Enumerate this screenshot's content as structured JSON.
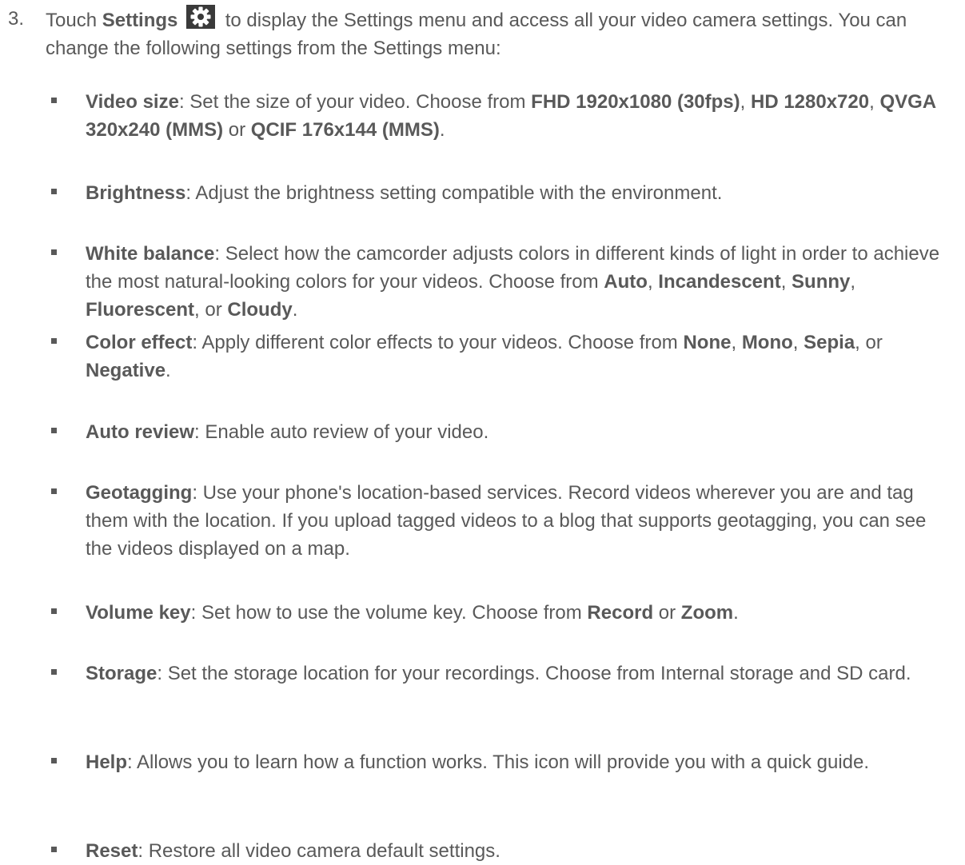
{
  "step": {
    "number": "3.",
    "text_1": "Touch ",
    "settings_label": "Settings",
    "icon": "gear-icon",
    "text_2": " to display the Settings menu and access all your video camera settings. You can change the following settings from the Settings menu:"
  },
  "items": [
    {
      "term": "Video size",
      "parts": [
        {
          "t": ": Set the size of your video. Choose from "
        },
        {
          "t": "FHD 1920x1080 (30fps)",
          "b": true
        },
        {
          "t": ", "
        },
        {
          "t": "HD 1280x720",
          "b": true
        },
        {
          "t": ", "
        },
        {
          "t": "QVGA 320x240 (MMS)",
          "b": true
        },
        {
          "t": " or "
        },
        {
          "t": "QCIF 176x144 (MMS)",
          "b": true
        },
        {
          "t": "."
        }
      ]
    },
    {
      "term": "Brightness",
      "parts": [
        {
          "t": ": Adjust the brightness setting compatible with the environment."
        }
      ]
    },
    {
      "term": "White balance",
      "parts": [
        {
          "t": ": Select how the camcorder adjusts colors in different kinds of light in order to achieve the most natural-looking colors for your videos. Choose from "
        },
        {
          "t": "Auto",
          "b": true
        },
        {
          "t": ", "
        },
        {
          "t": "Incandescent",
          "b": true
        },
        {
          "t": ", "
        },
        {
          "t": "Sunny",
          "b": true
        },
        {
          "t": ", "
        },
        {
          "t": "Fluorescent",
          "b": true
        },
        {
          "t": ", or "
        },
        {
          "t": "Cloudy",
          "b": true
        },
        {
          "t": "."
        }
      ]
    },
    {
      "term": "Color effect",
      "parts": [
        {
          "t": ": Apply different color effects to your videos. Choose from "
        },
        {
          "t": "None",
          "b": true
        },
        {
          "t": ", "
        },
        {
          "t": "Mono",
          "b": true
        },
        {
          "t": ", "
        },
        {
          "t": "Sepia",
          "b": true
        },
        {
          "t": ", or "
        },
        {
          "t": "Negative",
          "b": true
        },
        {
          "t": "."
        }
      ]
    },
    {
      "term": "Auto review",
      "parts": [
        {
          "t": ": Enable auto review of your video."
        }
      ]
    },
    {
      "term": "Geotagging",
      "parts": [
        {
          "t": ": Use your phone's location-based services. Record videos wherever you are and tag them with the location. If you upload tagged videos to a blog that supports geotagging, you can see the videos displayed on a map."
        }
      ]
    },
    {
      "term": "Volume key",
      "parts": [
        {
          "t": ": Set how to use the volume key. Choose from "
        },
        {
          "t": "Record",
          "b": true
        },
        {
          "t": " or "
        },
        {
          "t": "Zoom",
          "b": true
        },
        {
          "t": "."
        }
      ]
    },
    {
      "term": "Storage",
      "parts": [
        {
          "t": ": Set the storage location for your recordings. Choose from Internal storage and SD card."
        }
      ]
    },
    {
      "term": "Help",
      "parts": [
        {
          "t": ": Allows you to learn how a function works. This icon will provide you with a quick guide."
        }
      ]
    },
    {
      "term": "Reset",
      "parts": [
        {
          "t": ": Restore all video camera default settings."
        }
      ]
    }
  ]
}
